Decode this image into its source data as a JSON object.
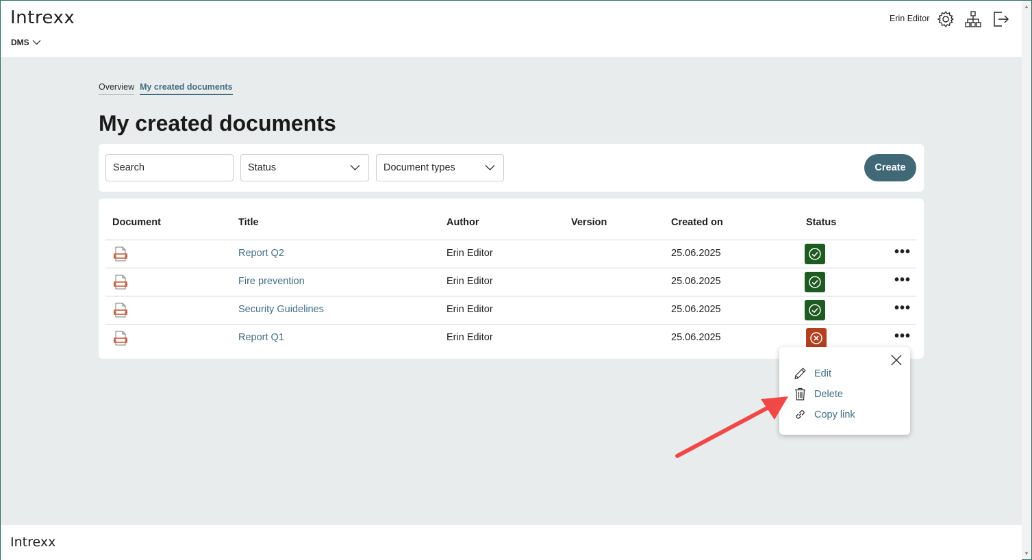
{
  "brand": {
    "logo": "Intrexx",
    "footer_logo": "Intrexx"
  },
  "app_switch": {
    "label": "DMS",
    "icon": "chevron-down-icon"
  },
  "header": {
    "user_name": "Erin Editor",
    "icons": [
      "gear-icon",
      "sitemap-icon",
      "logout-icon"
    ]
  },
  "tabs": [
    {
      "label": "Overview",
      "active": false
    },
    {
      "label": "My created documents",
      "active": true
    }
  ],
  "page_title": "My created documents",
  "filters": {
    "search_placeholder": "Search",
    "status_label": "Status",
    "doc_types_label": "Document types",
    "create_label": "Create"
  },
  "table": {
    "columns": [
      "Document",
      "Title",
      "Author",
      "Version",
      "Created on",
      "Status"
    ],
    "rows": [
      {
        "title": "Report Q2",
        "author": "Erin Editor",
        "version": "",
        "created": "25.06.2025",
        "status": "approved"
      },
      {
        "title": "Fire prevention",
        "author": "Erin Editor",
        "version": "",
        "created": "25.06.2025",
        "status": "approved"
      },
      {
        "title": "Security Guidelines",
        "author": "Erin Editor",
        "version": "",
        "created": "25.06.2025",
        "status": "approved"
      },
      {
        "title": "Report Q1",
        "author": "Erin Editor",
        "version": "",
        "created": "25.06.2025",
        "status": "rejected"
      }
    ],
    "more_label": "•••"
  },
  "context_menu": {
    "items": [
      {
        "label": "Edit",
        "icon": "pencil-icon"
      },
      {
        "label": "Delete",
        "icon": "trash-icon"
      },
      {
        "label": "Copy link",
        "icon": "link-icon"
      }
    ]
  },
  "colors": {
    "accent": "#406d83",
    "create_button": "#406877",
    "status_approved": "#1e5b22",
    "status_rejected": "#b3401f",
    "annotation_arrow": "#f04747",
    "main_bg": "#e9ecec"
  }
}
